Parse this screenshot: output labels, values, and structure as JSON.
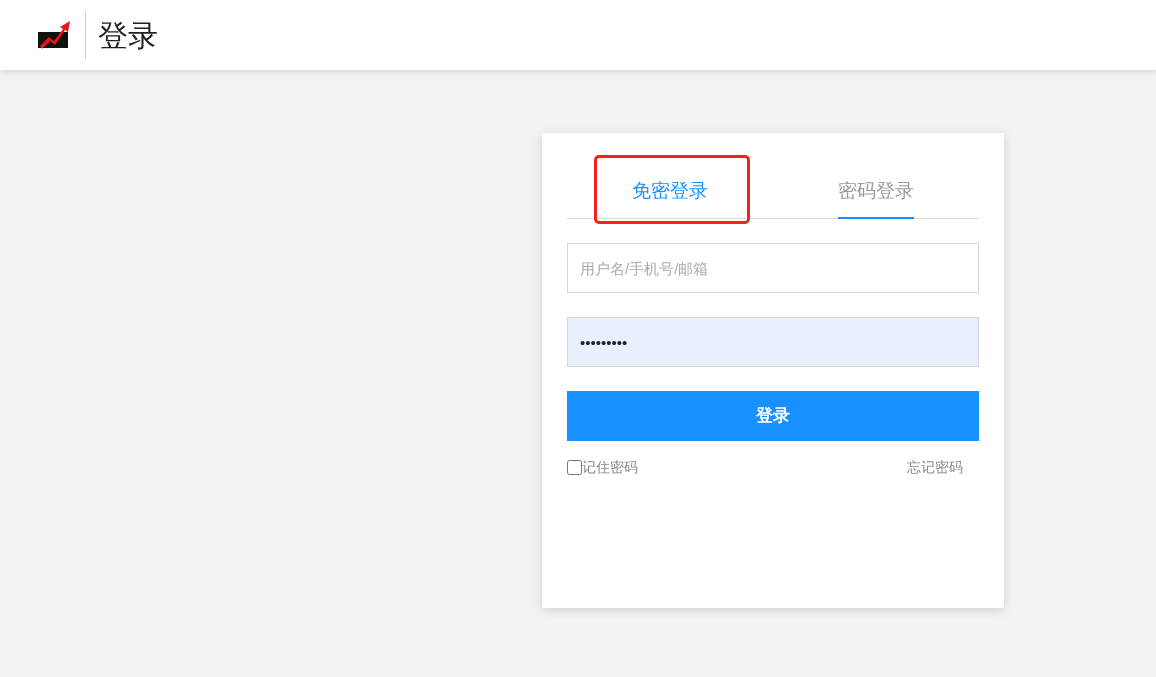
{
  "header": {
    "title": "登录"
  },
  "tabs": [
    {
      "label": "免密登录",
      "selected": true,
      "underlined": false,
      "highlighted": true
    },
    {
      "label": "密码登录",
      "selected": false,
      "underlined": true,
      "highlighted": false
    }
  ],
  "username": {
    "placeholder": "用户名/手机号/邮箱"
  },
  "password": {
    "value": "•••••••••",
    "autofilled": true
  },
  "login_button": {
    "label": "登录"
  },
  "remember": {
    "label": "记住密码",
    "checked": false
  },
  "forgot_link": {
    "label": "忘记密码"
  }
}
